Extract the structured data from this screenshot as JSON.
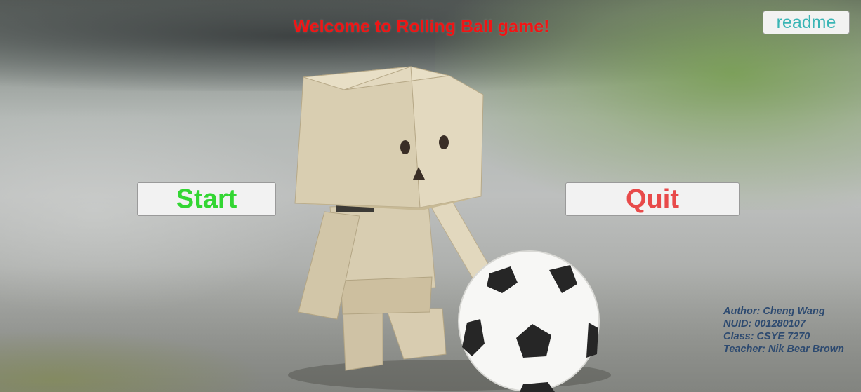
{
  "game": {
    "title": "Welcome to Rolling Ball game!"
  },
  "buttons": {
    "start_label": "Start",
    "quit_label": "Quit",
    "readme_label": "readme"
  },
  "credits": {
    "author": "Author: Cheng Wang",
    "nuid": "NUID: 001280107",
    "class": "Class: CSYE 7270",
    "teacher": "Teacher: Nik Bear Brown"
  },
  "colors": {
    "title": "#f01515",
    "start": "#33d633",
    "quit": "#e84a4a",
    "readme": "#3ab5b5",
    "credits": "#2d4a70"
  },
  "icons": {
    "background": "cardboard-robot-with-soccer-ball-photo"
  }
}
